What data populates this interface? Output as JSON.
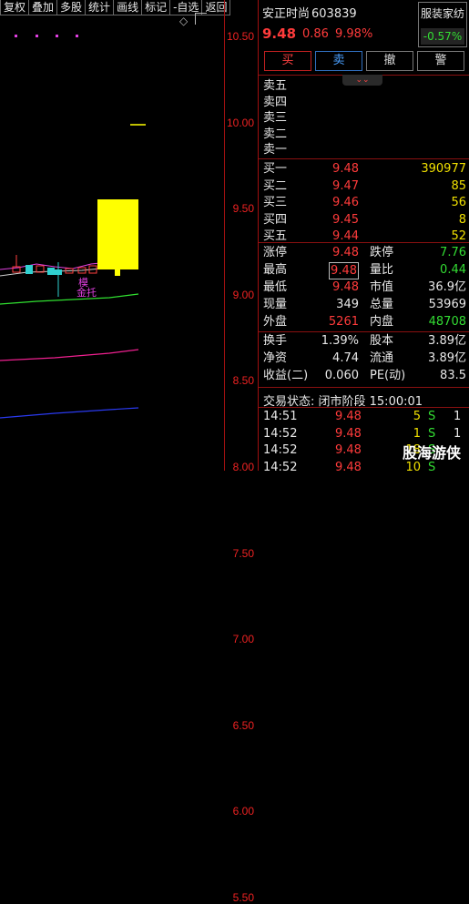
{
  "toolbar": [
    "复权",
    "叠加",
    "多股",
    "统计",
    "画线",
    "标记",
    "-自选",
    "返回"
  ],
  "axis_ticks": [
    "10.50",
    "10.00",
    "9.50",
    "9.00",
    "8.50",
    "8.00",
    "7.50",
    "7.00",
    "6.50",
    "6.00",
    "5.50"
  ],
  "chart_annotation": {
    "line1": "模",
    "line2": "金托"
  },
  "stock": {
    "name": "安正时尚",
    "code": "603839",
    "price": "9.48",
    "change": "0.86",
    "change_pct": "9.98%"
  },
  "sector": {
    "name": "服装家纺",
    "pct": "-0.57%"
  },
  "actions": {
    "buy": "买",
    "sell": "卖",
    "cancel": "撤",
    "alert": "警"
  },
  "collapse_icon": "chevrons-down-icon",
  "asks": [
    {
      "label": "卖五",
      "price": "",
      "vol": ""
    },
    {
      "label": "卖四",
      "price": "",
      "vol": ""
    },
    {
      "label": "卖三",
      "price": "",
      "vol": ""
    },
    {
      "label": "卖二",
      "price": "",
      "vol": ""
    },
    {
      "label": "卖一",
      "price": "",
      "vol": ""
    }
  ],
  "bids": [
    {
      "label": "买一",
      "price": "9.48",
      "vol": "390977"
    },
    {
      "label": "买二",
      "price": "9.47",
      "vol": "85"
    },
    {
      "label": "买三",
      "price": "9.46",
      "vol": "56"
    },
    {
      "label": "买四",
      "price": "9.45",
      "vol": "8"
    },
    {
      "label": "买五",
      "price": "9.44",
      "vol": "52"
    }
  ],
  "quote": [
    {
      "l1": "涨停",
      "v1": "9.48",
      "c1": "red",
      "l2": "跌停",
      "v2": "7.76",
      "c2": "green"
    },
    {
      "l1": "最高",
      "v1": "9.48",
      "c1": "red",
      "l2": "量比",
      "v2": "0.44",
      "c2": "green",
      "box": true
    },
    {
      "l1": "最低",
      "v1": "9.48",
      "c1": "red",
      "l2": "市值",
      "v2": "36.9亿",
      "c2": "white"
    },
    {
      "l1": "现量",
      "v1": "349",
      "c1": "white",
      "l2": "总量",
      "v2": "53969",
      "c2": "white"
    },
    {
      "l1": "外盘",
      "v1": "5261",
      "c1": "red",
      "l2": "内盘",
      "v2": "48708",
      "c2": "green"
    }
  ],
  "fundamentals": [
    {
      "l1": "换手",
      "v1": "1.39%",
      "l2": "股本",
      "v2": "3.89亿"
    },
    {
      "l1": "净资",
      "v1": "4.74",
      "l2": "流通",
      "v2": "3.89亿"
    },
    {
      "l1": "收益(二)",
      "v1": "0.060",
      "l2": "PE(动)",
      "v2": "83.5"
    }
  ],
  "status": "交易状态: 闭市阶段 15:00:01",
  "ticks": [
    {
      "time": "14:51",
      "price": "9.48",
      "vol": "5",
      "bs": "S",
      "n": "1"
    },
    {
      "time": "14:52",
      "price": "9.48",
      "vol": "1",
      "bs": "S",
      "n": "1"
    },
    {
      "time": "14:52",
      "price": "9.48",
      "vol": "18",
      "bs": "S",
      "n": ""
    },
    {
      "time": "14:52",
      "price": "9.48",
      "vol": "10",
      "bs": "S",
      "n": ""
    }
  ],
  "watermark": "股海游侠"
}
